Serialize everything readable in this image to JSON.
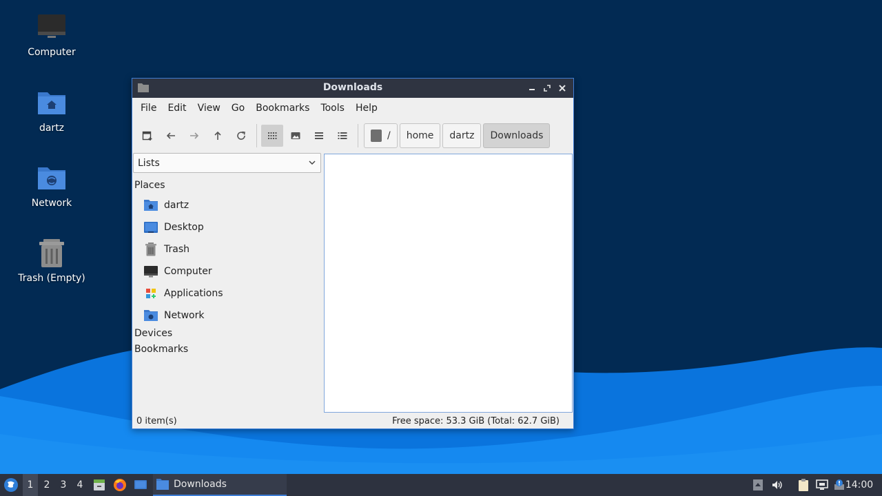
{
  "desktop": {
    "icons": [
      {
        "label": "Computer"
      },
      {
        "label": "dartz"
      },
      {
        "label": "Network"
      },
      {
        "label": "Trash (Empty)"
      }
    ]
  },
  "window": {
    "title": "Downloads",
    "menu": [
      "File",
      "Edit",
      "View",
      "Go",
      "Bookmarks",
      "Tools",
      "Help"
    ],
    "toolbar": {
      "buttons": [
        "new-tab-icon",
        "back-icon",
        "forward-icon",
        "up-icon",
        "reload-icon",
        "icon-view-icon",
        "thumbnail-view-icon",
        "compact-list-icon",
        "detail-list-icon"
      ],
      "breadcrumbs": [
        {
          "label": "/"
        },
        {
          "label": "home"
        },
        {
          "label": "dartz"
        },
        {
          "label": "Downloads",
          "current": true
        }
      ]
    },
    "sidepane": {
      "mode": "Lists",
      "sections": {
        "places": "Places",
        "devices": "Devices",
        "bookmarks": "Bookmarks"
      },
      "places": [
        {
          "label": "dartz",
          "icon": "home-folder-icon"
        },
        {
          "label": "Desktop",
          "icon": "desktop-icon"
        },
        {
          "label": "Trash",
          "icon": "trash-icon"
        },
        {
          "label": "Computer",
          "icon": "computer-icon"
        },
        {
          "label": "Applications",
          "icon": "applications-icon"
        },
        {
          "label": "Network",
          "icon": "network-folder-icon"
        }
      ]
    },
    "status": {
      "items": "0 item(s)",
      "free_space": "Free space: 53.3 GiB (Total: 62.7 GiB)"
    }
  },
  "taskbar": {
    "workspaces": [
      "1",
      "2",
      "3",
      "4"
    ],
    "active_workspace": "1",
    "task": "Downloads",
    "clock": "14:00"
  },
  "colors": {
    "accent": "#3d7dd6",
    "titlebar": "#2f3441",
    "folder": "#4a8be0",
    "wallpaper_dark": "#022a53",
    "wallpaper_wave": "#0f7ee8"
  }
}
